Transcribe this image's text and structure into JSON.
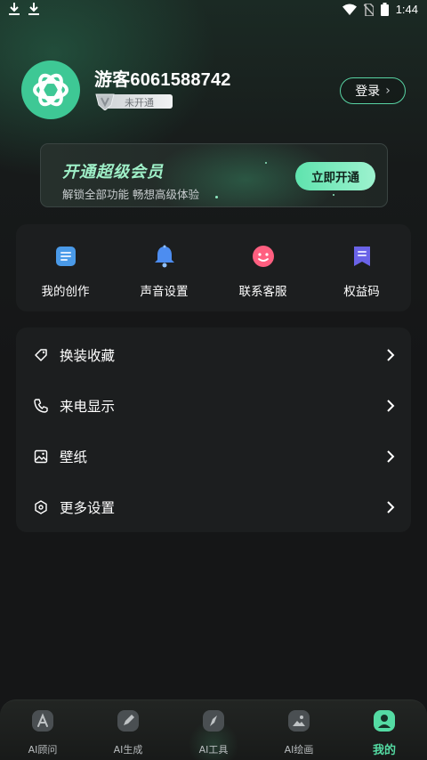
{
  "status_bar": {
    "time": "1:44"
  },
  "profile": {
    "username": "游客6061588742",
    "vip_status": "未开通",
    "login_label": "登录",
    "login_chevron": "›"
  },
  "vip_banner": {
    "title": "开通超级会员",
    "subtitle": "解锁全部功能 畅想高级体验",
    "button_label": "立即开通"
  },
  "quick_actions": [
    {
      "label": "我的创作",
      "icon": "document-icon"
    },
    {
      "label": "声音设置",
      "icon": "bell-icon"
    },
    {
      "label": "联系客服",
      "icon": "smile-face-icon"
    },
    {
      "label": "权益码",
      "icon": "bookmark-code-icon"
    }
  ],
  "menu": [
    {
      "label": "换装收藏",
      "icon": "tag-icon"
    },
    {
      "label": "来电显示",
      "icon": "phone-icon"
    },
    {
      "label": "壁纸",
      "icon": "image-icon"
    },
    {
      "label": "更多设置",
      "icon": "settings-hex-icon"
    }
  ],
  "bottom_nav": [
    {
      "label": "AI顾问",
      "icon": "ai-advisor-icon",
      "active": false
    },
    {
      "label": "AI生成",
      "icon": "pencil-icon",
      "active": false
    },
    {
      "label": "AI工具",
      "icon": "compass-icon",
      "active": false
    },
    {
      "label": "AI绘画",
      "icon": "picture-icon",
      "active": false
    },
    {
      "label": "我的",
      "icon": "profile-icon",
      "active": true
    }
  ],
  "colors": {
    "accent": "#54dba3",
    "background": "#151617",
    "card": "#1c1e1f"
  }
}
